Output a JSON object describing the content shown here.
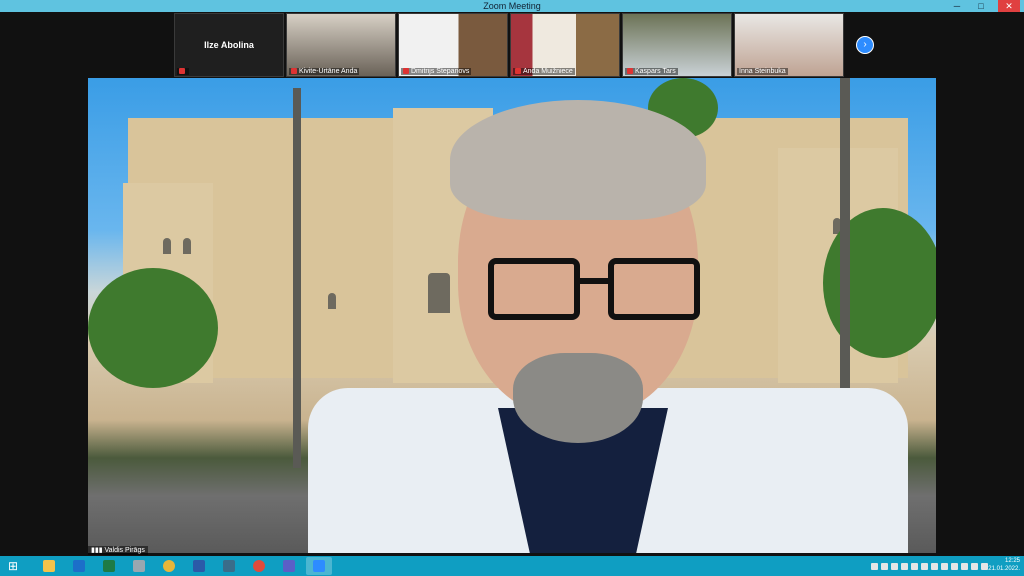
{
  "window": {
    "title": "Zoom Meeting",
    "controls": [
      "─",
      "□",
      "✕"
    ]
  },
  "gallery": {
    "participants": [
      {
        "name": "Ilze Abolina",
        "video": false,
        "muted": true
      },
      {
        "name": "Kivite-Urtāne Anda",
        "video": true,
        "muted": true
      },
      {
        "name": "Dmitrijs Stepanovs",
        "video": true,
        "muted": true
      },
      {
        "name": "Anda Muižniece",
        "video": true,
        "muted": true
      },
      {
        "name": "Kaspars Tars",
        "video": true,
        "muted": true
      },
      {
        "name": "Inna Steinbuka",
        "video": true,
        "muted": false
      }
    ],
    "next_icon": "chevron-right-icon"
  },
  "active_speaker": {
    "name": "Valdis Pirāgs"
  },
  "taskbar": {
    "apps": [
      {
        "icon": "file-explorer-icon",
        "color": "#f4c34a"
      },
      {
        "icon": "outlook-icon",
        "color": "#1c6fc9"
      },
      {
        "icon": "excel-icon",
        "color": "#1e7b45"
      },
      {
        "icon": "calculator-icon",
        "color": "#9aa7b0"
      },
      {
        "icon": "chrome-icon",
        "color": "#e8b63a"
      },
      {
        "icon": "word-icon",
        "color": "#2b5aa8"
      },
      {
        "icon": "app-icon",
        "color": "#3a6d8a"
      },
      {
        "icon": "chrome-icon",
        "color": "#e04b3c"
      },
      {
        "icon": "teams-icon",
        "color": "#5b5fc7"
      },
      {
        "icon": "zoom-icon",
        "color": "#2d8cff"
      }
    ],
    "time": "12:25",
    "date": "21.01.2022."
  },
  "colors": {
    "titlebar": "#5fc3e0",
    "taskbar": "#0f9ec2",
    "accent": "#2d8cff"
  }
}
